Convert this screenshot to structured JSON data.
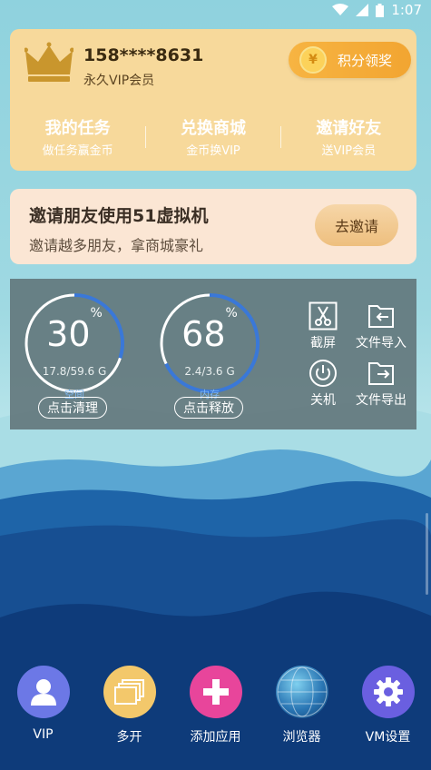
{
  "status_bar": {
    "time": "1:07"
  },
  "vip": {
    "phone": "158****8631",
    "member_type": "永久VIP会员",
    "points_button": "积分领奖",
    "menu": [
      {
        "title": "我的任务",
        "subtitle": "做任务赢金币"
      },
      {
        "title": "兑换商城",
        "subtitle": "金币换VIP"
      },
      {
        "title": "邀请好友",
        "subtitle": "送VIP会员"
      }
    ]
  },
  "invite": {
    "title": "邀请朋友使用51虚拟机",
    "subtitle": "邀请越多朋友，拿商城豪礼",
    "button": "去邀请"
  },
  "stats": {
    "storage": {
      "percent": "30",
      "percent_value": 0.3,
      "size": "17.8/59.6 G",
      "label": "空间",
      "button": "点击清理"
    },
    "memory": {
      "percent": "68",
      "percent_value": 0.68,
      "size": "2.4/3.6 G",
      "label": "内存",
      "button": "点击释放"
    },
    "percent_sign": "%",
    "tools": {
      "screenshot": "截屏",
      "import": "文件导入",
      "shutdown": "关机",
      "export": "文件导出"
    }
  },
  "dock": [
    {
      "label": "VIP",
      "icon": "user-icon",
      "color": "#6c78e6"
    },
    {
      "label": "多开",
      "icon": "stack-icon",
      "color": "#f3c86b"
    },
    {
      "label": "添加应用",
      "icon": "plus-icon",
      "color": "#e8459b"
    },
    {
      "label": "浏览器",
      "icon": "globe-icon",
      "color": "#2b6fa8"
    },
    {
      "label": "VM设置",
      "icon": "gear-icon",
      "color": "#6a5fe0"
    }
  ]
}
